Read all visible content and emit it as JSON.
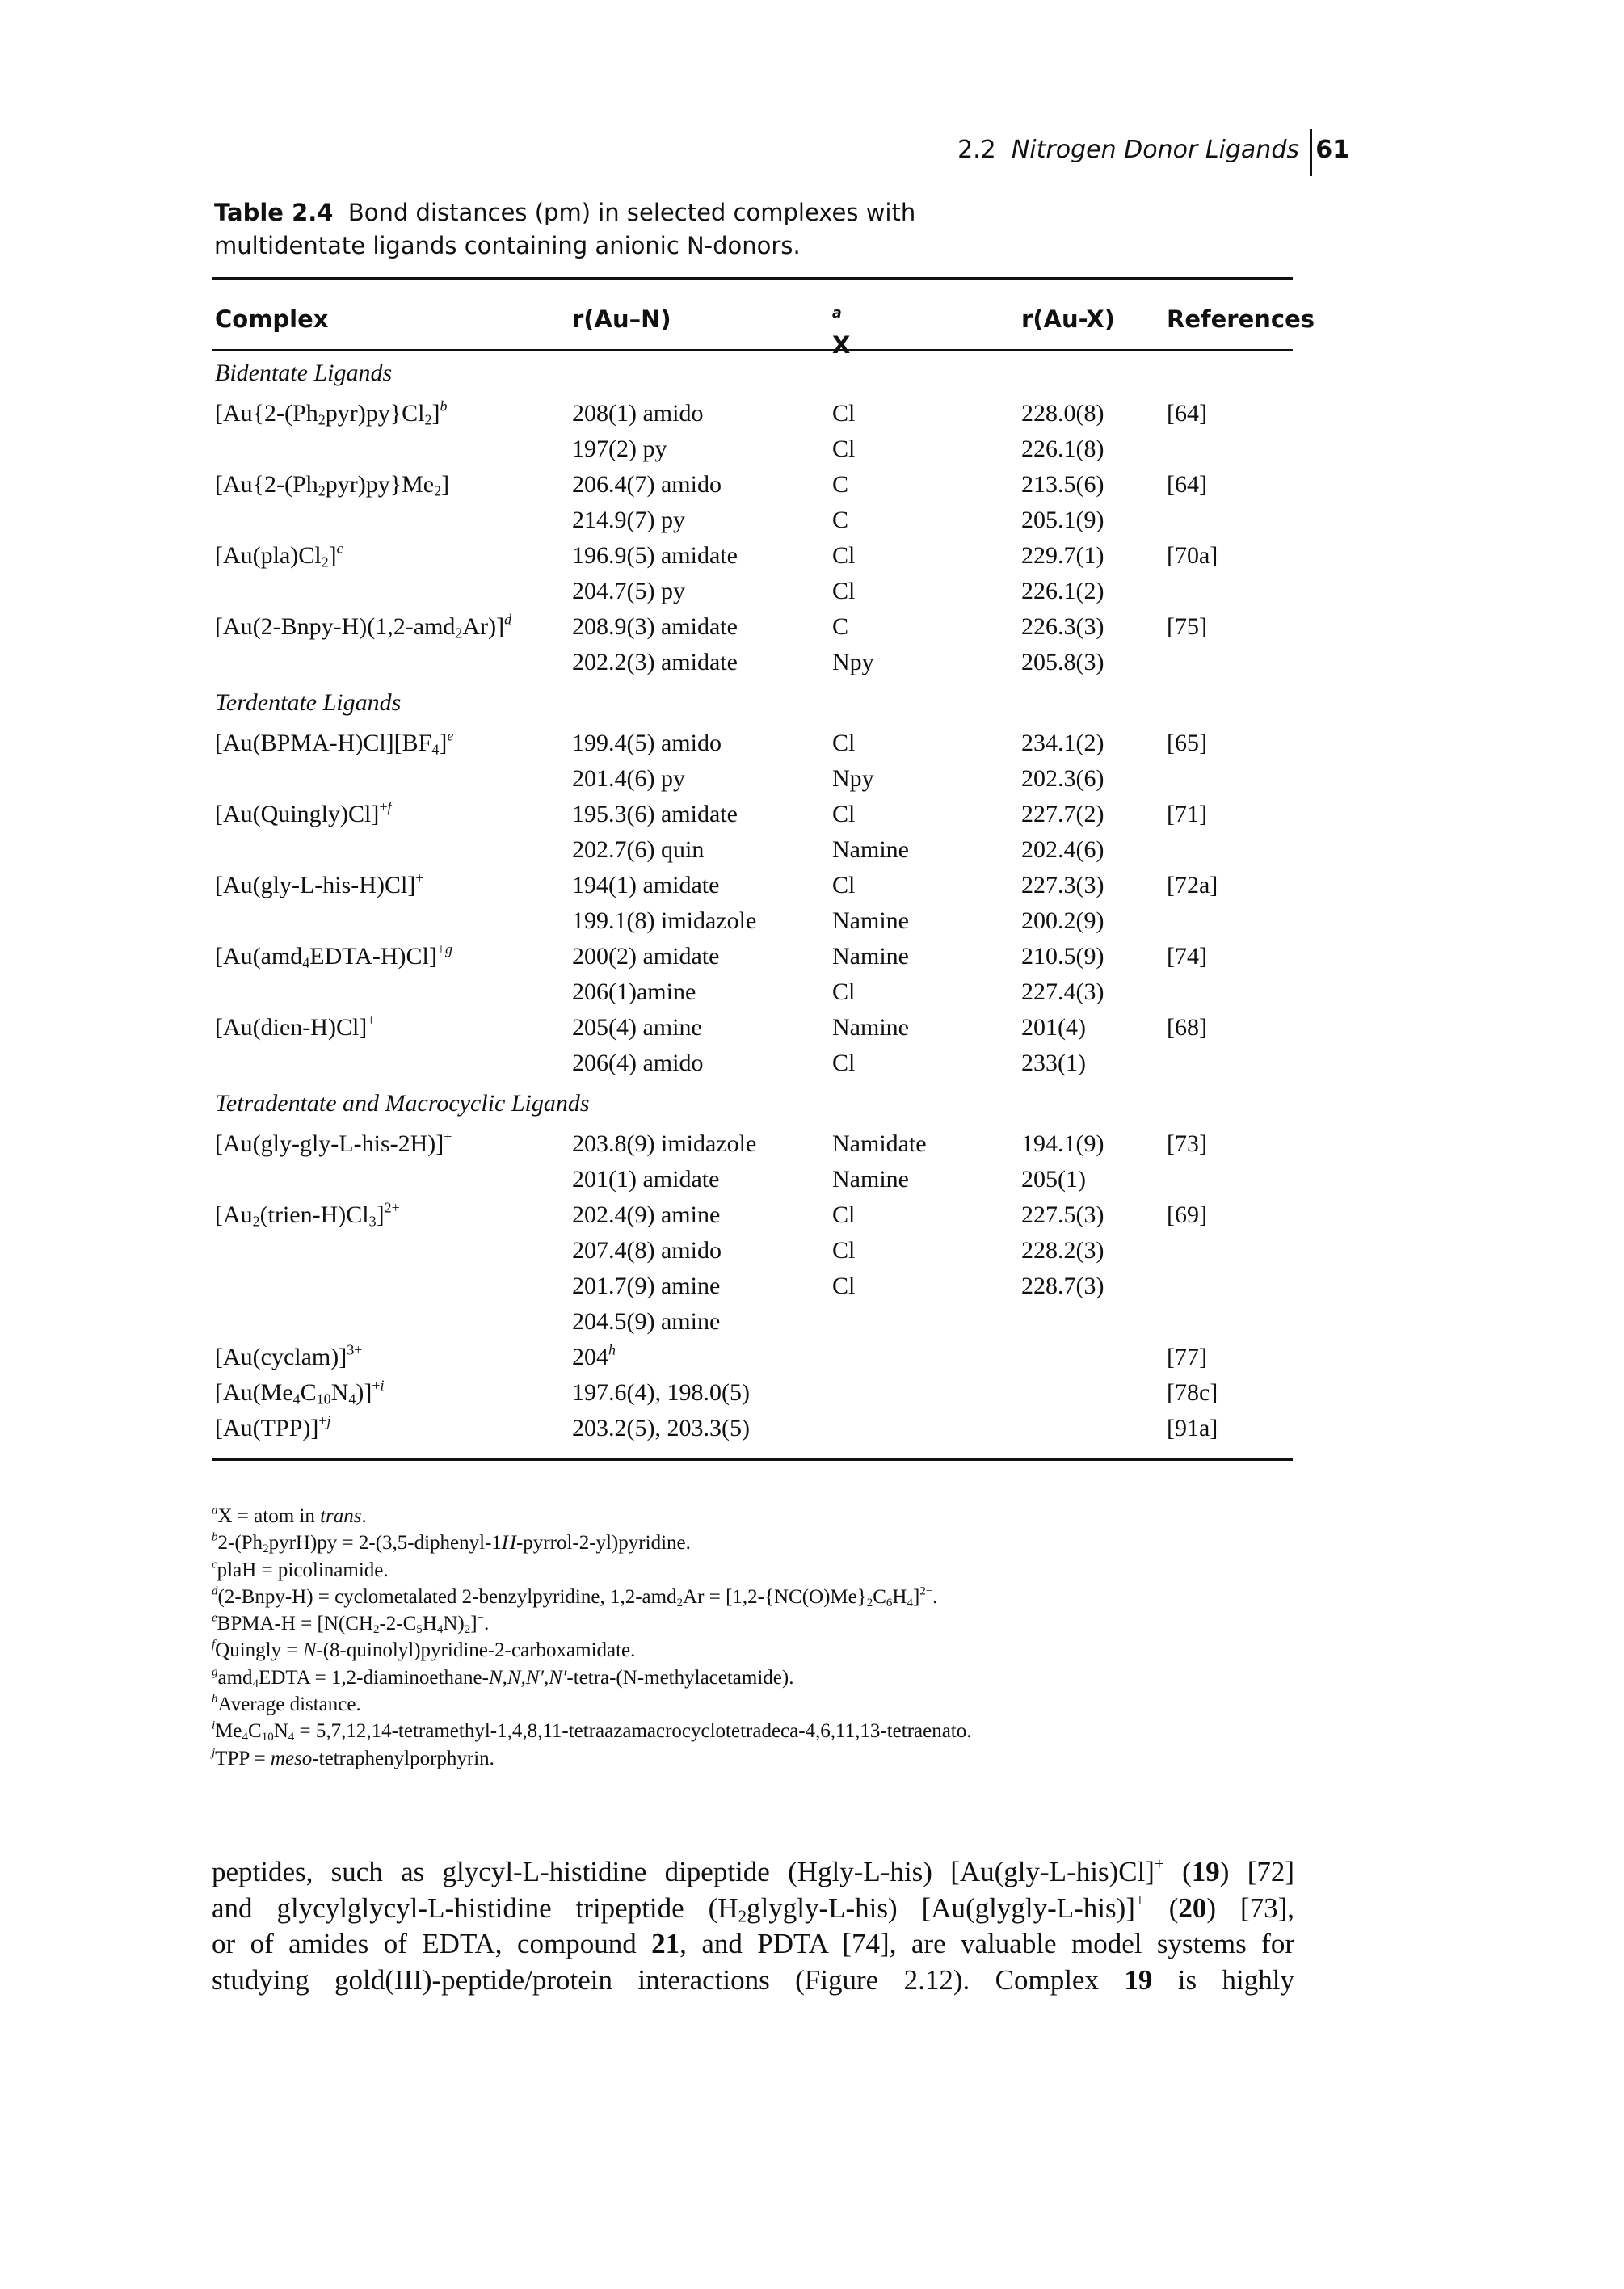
{
  "running_head": {
    "section_number": "2.2",
    "section_title": "Nitrogen Donor Ligands",
    "page_number": "61"
  },
  "caption": {
    "label": "Table 2.4",
    "text": "Bond distances (pm) in selected complexes with multidentate ligands containing anionic N-donors."
  },
  "table": {
    "headers": {
      "complex": "Complex",
      "r_au_n": "r(Au–N)",
      "x": "X",
      "x_note": "a",
      "r_au_x": "r(Au-X)",
      "references": "References"
    },
    "sections": [
      {
        "title": "Bidentate Ligands",
        "rows": [
          {
            "complex_html": "[Au{2-(Ph<sub>2</sub>pyr)py}Cl<sub>2</sub>]<sup><i>b</i></sup>",
            "r_au_n": "208(1) amido",
            "x": "Cl",
            "r_au_x": "228.0(8)",
            "ref": "[64]"
          },
          {
            "complex_html": "",
            "r_au_n": "197(2) py",
            "x": "Cl",
            "r_au_x": "226.1(8)",
            "ref": ""
          },
          {
            "complex_html": "[Au{2-(Ph<sub>2</sub>pyr)py}Me<sub>2</sub>]",
            "r_au_n": "206.4(7) amido",
            "x": "C",
            "r_au_x": "213.5(6)",
            "ref": "[64]"
          },
          {
            "complex_html": "",
            "r_au_n": "214.9(7) py",
            "x": "C",
            "r_au_x": "205.1(9)",
            "ref": ""
          },
          {
            "complex_html": "[Au(pla)Cl<sub>2</sub>]<sup><i>c</i></sup>",
            "r_au_n": "196.9(5) amidate",
            "x": "Cl",
            "r_au_x": "229.7(1)",
            "ref": "[70a]"
          },
          {
            "complex_html": "",
            "r_au_n": "204.7(5) py",
            "x": "Cl",
            "r_au_x": "226.1(2)",
            "ref": ""
          },
          {
            "complex_html": "[Au(2-Bnpy-H)(1,2-amd<sub>2</sub>Ar)]<sup><i>d</i></sup>",
            "r_au_n": "208.9(3) amidate",
            "x": "C",
            "r_au_x": "226.3(3)",
            "ref": "[75]"
          },
          {
            "complex_html": "",
            "r_au_n": "202.2(3) amidate",
            "x": "Npy",
            "r_au_x": "205.8(3)",
            "ref": ""
          }
        ]
      },
      {
        "title": "Terdentate Ligands",
        "rows": [
          {
            "complex_html": "[Au(BPMA-H)Cl][BF<sub>4</sub>]<sup><i>e</i></sup>",
            "r_au_n": "199.4(5) amido",
            "x": "Cl",
            "r_au_x": "234.1(2)",
            "ref": "[65]"
          },
          {
            "complex_html": "",
            "r_au_n": "201.4(6) py",
            "x": "Npy",
            "r_au_x": "202.3(6)",
            "ref": ""
          },
          {
            "complex_html": "[Au(Quingly)Cl]<sup>+<i>f</i></sup>",
            "r_au_n": "195.3(6) amidate",
            "x": "Cl",
            "r_au_x": "227.7(2)",
            "ref": "[71]"
          },
          {
            "complex_html": "",
            "r_au_n": "202.7(6) quin",
            "x": "Namine",
            "r_au_x": "202.4(6)",
            "ref": ""
          },
          {
            "complex_html": "[Au(gly-L-his-H)Cl]<sup>+</sup>",
            "r_au_n": "194(1) amidate",
            "x": "Cl",
            "r_au_x": "227.3(3)",
            "ref": "[72a]"
          },
          {
            "complex_html": "",
            "r_au_n": "199.1(8) imidazole",
            "x": "Namine",
            "r_au_x": "200.2(9)",
            "ref": ""
          },
          {
            "complex_html": "[Au(amd<sub>4</sub>EDTA-H)Cl]<sup>+<i>g</i></sup>",
            "r_au_n": "200(2) amidate",
            "x": "Namine",
            "r_au_x": "210.5(9)",
            "ref": "[74]"
          },
          {
            "complex_html": "",
            "r_au_n": "206(1)amine",
            "x": "Cl",
            "r_au_x": "227.4(3)",
            "ref": ""
          },
          {
            "complex_html": "[Au(dien-H)Cl]<sup>+</sup>",
            "r_au_n": "205(4) amine",
            "x": "Namine",
            "r_au_x": "201(4)",
            "ref": "[68]"
          },
          {
            "complex_html": "",
            "r_au_n": "206(4) amido",
            "x": "Cl",
            "r_au_x": "233(1)",
            "ref": ""
          }
        ]
      },
      {
        "title": "Tetradentate and Macrocyclic Ligands",
        "rows": [
          {
            "complex_html": "[Au(gly-gly-L-his-2H)]<sup>+</sup>",
            "r_au_n": "203.8(9) imidazole",
            "x": "Namidate",
            "r_au_x": "194.1(9)",
            "ref": "[73]"
          },
          {
            "complex_html": "",
            "r_au_n": "201(1) amidate",
            "x": "Namine",
            "r_au_x": "205(1)",
            "ref": ""
          },
          {
            "complex_html": "[Au<sub>2</sub>(trien-H)Cl<sub>3</sub>]<sup>2+</sup>",
            "r_au_n": "202.4(9) amine",
            "x": "Cl",
            "r_au_x": "227.5(3)",
            "ref": "[69]"
          },
          {
            "complex_html": "",
            "r_au_n": "207.4(8) amido",
            "x": "Cl",
            "r_au_x": "228.2(3)",
            "ref": ""
          },
          {
            "complex_html": "",
            "r_au_n": "201.7(9) amine",
            "x": "Cl",
            "r_au_x": "228.7(3)",
            "ref": ""
          },
          {
            "complex_html": "",
            "r_au_n": "204.5(9) amine",
            "x": "",
            "r_au_x": "",
            "ref": ""
          },
          {
            "complex_html": "[Au(cyclam)]<sup>3+</sup>",
            "r_au_n_html": "204<sup><i>h</i></sup>",
            "r_au_n": "",
            "x": "",
            "r_au_x": "",
            "ref": "[77]"
          },
          {
            "complex_html": "[Au(Me<sub>4</sub>C<sub>10</sub>N<sub>4</sub>)]<sup>+<i>i</i></sup>",
            "r_au_n": "197.6(4), 198.0(5)",
            "x": "",
            "r_au_x": "",
            "ref": "[78c]"
          },
          {
            "complex_html": "[Au(TPP)]<sup>+<i>j</i></sup>",
            "r_au_n": "203.2(5), 203.3(5)",
            "x": "",
            "r_au_x": "",
            "ref": "[91a]"
          }
        ]
      }
    ]
  },
  "footnotes": [
    "<sup><i>a</i></sup>X = atom in <i>trans</i>.",
    "<sup><i>b</i></sup>2-(Ph<sub>2</sub>pyrH)py = 2-(3,5-diphenyl-1<i>H</i>-pyrrol-2-yl)pyridine.",
    "<sup><i>c</i></sup>plaH = picolinamide.",
    "<sup><i>d</i></sup>(2-Bnpy-H) = cyclometalated 2-benzylpyridine, 1,2-amd<sub>2</sub>Ar = [1,2-{NC(O)Me}<sub>2</sub>C<sub>6</sub>H<sub>4</sub>]<sup>2−</sup>.",
    "<sup><i>e</i></sup>BPMA-H = [N(CH<sub>2</sub>-2-C<sub>5</sub>H<sub>4</sub>N)<sub>2</sub>]<sup>−</sup>.",
    "<sup><i>f</i></sup>Quingly = <i>N</i>-(8-quinolyl)pyridine-2-carboxamidate.",
    "<sup><i>g</i></sup>amd<sub>4</sub>EDTA = 1,2-diaminoethane-<i>N,N,N′,N′</i>-tetra-(N-methylacetamide).",
    "<sup><i>h</i></sup>Average distance.",
    "<sup><i>i</i></sup>Me<sub>4</sub>C<sub>10</sub>N<sub>4</sub> = 5,7,12,14-tetramethyl-1,4,8,11-tetraazamacrocyclotetradeca-4,6,11,13-tetraenato.",
    "<sup><i>j</i></sup>TPP = <i>meso</i>-tetraphenylporphyrin."
  ],
  "body_text_lines": [
    "peptides, such as glycyl-L-histidine dipeptide (Hgly-L-his) [Au(gly-L-his)Cl]<sup>+</sup> (<b>19</b>) [72]",
    "and glycylglycyl-L-histidine tripeptide (H<sub>2</sub>glygly-L-his) [Au(glygly-L-his)]<sup>+</sup> (<b>20</b>) [73],",
    "or of amides of EDTA, compound <b>21</b>, and PDTA [74], are valuable model systems for",
    "studying gold(III)-peptide/protein interactions (Figure 2.12). Complex <b>19</b> is highly"
  ]
}
